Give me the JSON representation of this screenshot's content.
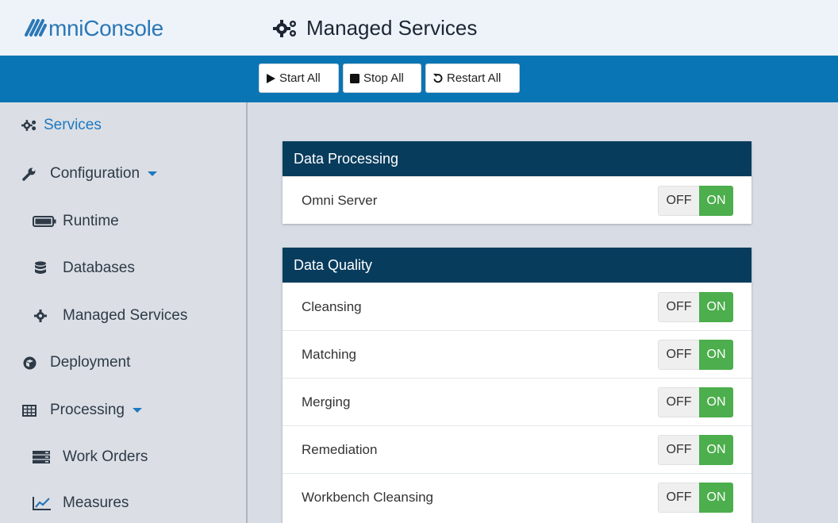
{
  "app": {
    "brand_name": "mniConsole",
    "page_title": "Managed Services"
  },
  "toolbar": {
    "start_label": "Start All",
    "stop_label": "Stop All",
    "restart_label": "Restart All"
  },
  "sidebar": {
    "items": [
      {
        "label": "Services",
        "icon": "cogs-icon",
        "active": true
      },
      {
        "label": "Configuration",
        "icon": "wrench-icon",
        "dropdown": true
      },
      {
        "label": "Runtime",
        "icon": "battery-icon"
      },
      {
        "label": "Databases",
        "icon": "database-icon"
      },
      {
        "label": "Managed Services",
        "icon": "gear-icon"
      },
      {
        "label": "Deployment",
        "icon": "cube-icon"
      },
      {
        "label": "Processing",
        "icon": "table-icon",
        "dropdown": true
      },
      {
        "label": "Work Orders",
        "icon": "server-icon"
      },
      {
        "label": "Measures",
        "icon": "line-chart-icon"
      }
    ]
  },
  "panels": [
    {
      "title": "Data Processing",
      "services": [
        {
          "name": "Omni Server",
          "off_label": "OFF",
          "on_label": "ON",
          "state": "ON"
        }
      ]
    },
    {
      "title": "Data Quality",
      "services": [
        {
          "name": "Cleansing",
          "off_label": "OFF",
          "on_label": "ON",
          "state": "ON"
        },
        {
          "name": "Matching",
          "off_label": "OFF",
          "on_label": "ON",
          "state": "ON"
        },
        {
          "name": "Merging",
          "off_label": "OFF",
          "on_label": "ON",
          "state": "ON"
        },
        {
          "name": "Remediation",
          "off_label": "OFF",
          "on_label": "ON",
          "state": "ON"
        },
        {
          "name": "Workbench Cleansing",
          "off_label": "OFF",
          "on_label": "ON",
          "state": "ON"
        }
      ]
    }
  ],
  "colors": {
    "brand_blue": "#2a77b6",
    "action_bar": "#0a75b5",
    "panel_header": "#083c5d",
    "toggle_on": "#4cae4c"
  }
}
